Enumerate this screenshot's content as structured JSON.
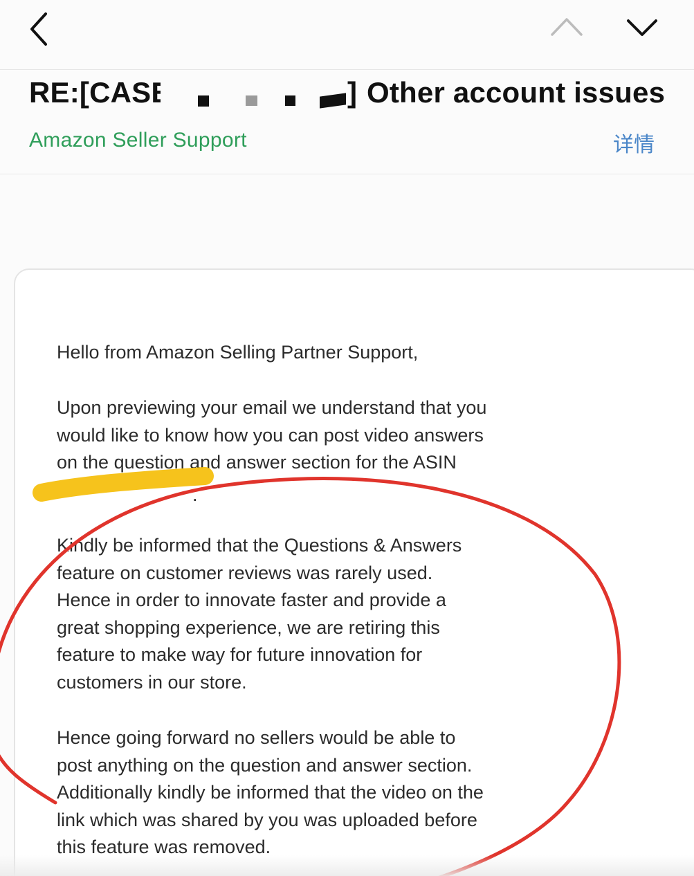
{
  "nav": {
    "back_icon": "chevron-left-icon",
    "prev_icon": "chevron-up-icon",
    "next_icon": "chevron-down-icon"
  },
  "email": {
    "subject_prefix": "RE:[CASE",
    "subject_close": "]",
    "subject_suffix": "Other account issues",
    "sender": "Amazon Seller Support",
    "details_label": "详情"
  },
  "message": {
    "greeting": "Hello from Amazon Selling Partner Support,",
    "intro": "Upon previewing your email we understand that you\nwould like to know how you can post video answers\non the question and answer section for the ASIN",
    "asin_trailing": ".",
    "info": "Kindly be informed that the Questions & Answers\nfeature on customer reviews was rarely used.\nHence in order to innovate faster and provide a\ngreat shopping experience, we are retiring this\nfeature to make way for future innovation for\ncustomers in our store.",
    "forward": "Hence going forward no sellers would be able to\npost anything on the question and answer section.\nAdditionally kindly be informed that the video on the\nlink which was shared by you was uploaded before\nthis feature was removed."
  },
  "colors": {
    "sender_green": "#2f9e5a",
    "details_blue": "#4a86c8",
    "highlighter_yellow": "#f5c010",
    "annotation_red": "#e0342c",
    "redaction_black": "#111111"
  }
}
